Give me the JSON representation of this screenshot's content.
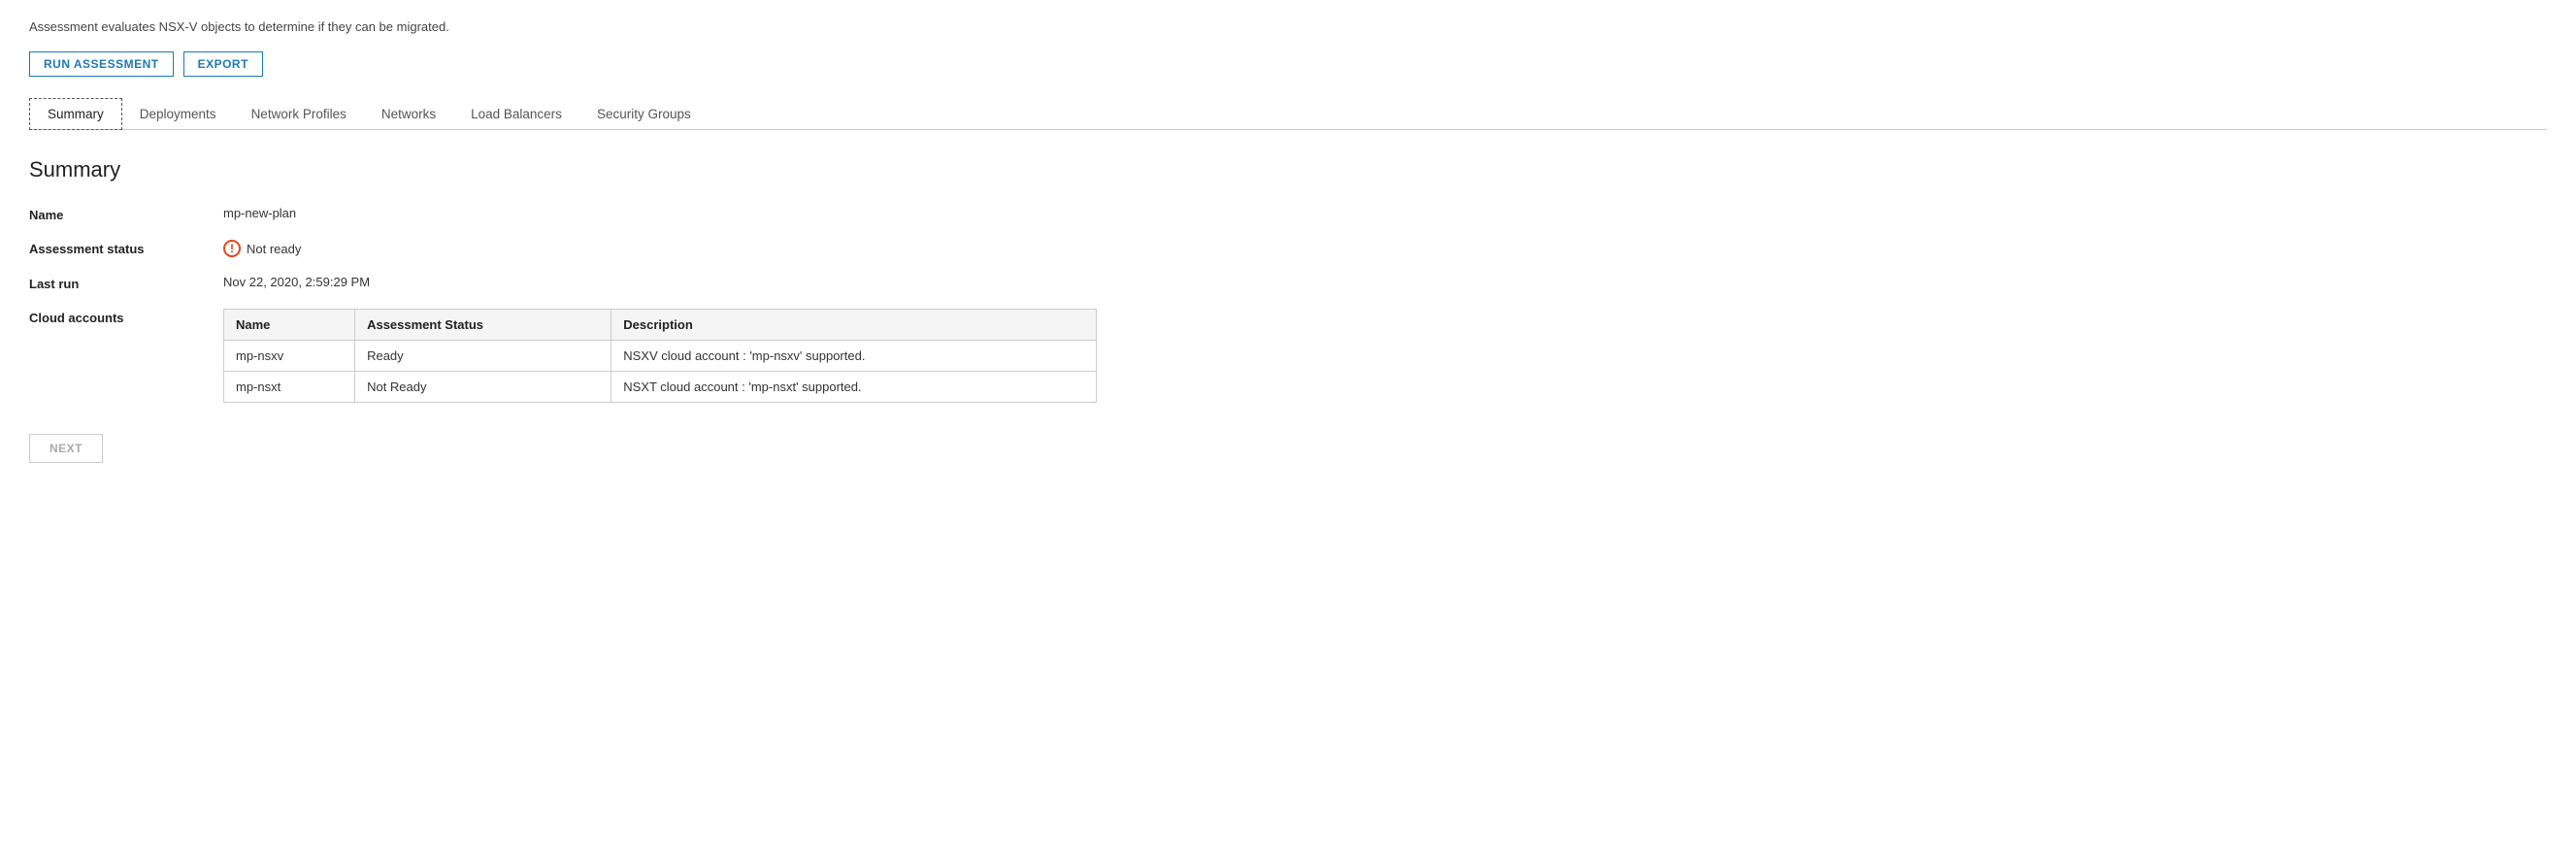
{
  "description": "Assessment evaluates NSX-V objects to determine if they can be migrated.",
  "toolbar": {
    "run_assessment_label": "RUN ASSESSMENT",
    "export_label": "EXPORT"
  },
  "tabs": [
    {
      "id": "summary",
      "label": "Summary",
      "active": true
    },
    {
      "id": "deployments",
      "label": "Deployments",
      "active": false
    },
    {
      "id": "network-profiles",
      "label": "Network Profiles",
      "active": false
    },
    {
      "id": "networks",
      "label": "Networks",
      "active": false
    },
    {
      "id": "load-balancers",
      "label": "Load Balancers",
      "active": false
    },
    {
      "id": "security-groups",
      "label": "Security Groups",
      "active": false
    }
  ],
  "section_title": "Summary",
  "fields": {
    "name_label": "Name",
    "name_value": "mp-new-plan",
    "status_label": "Assessment status",
    "status_value": "Not ready",
    "last_run_label": "Last run",
    "last_run_value": "Nov 22, 2020, 2:59:29 PM",
    "cloud_accounts_label": "Cloud accounts"
  },
  "table": {
    "headers": [
      "Name",
      "Assessment Status",
      "Description"
    ],
    "rows": [
      {
        "name": "mp-nsxv",
        "assessment_status": "Ready",
        "description": "NSXV cloud account : 'mp-nsxv' supported."
      },
      {
        "name": "mp-nsxt",
        "assessment_status": "Not Ready",
        "description": "NSXT cloud account : 'mp-nsxt' supported."
      }
    ]
  },
  "next_button_label": "NEXT"
}
